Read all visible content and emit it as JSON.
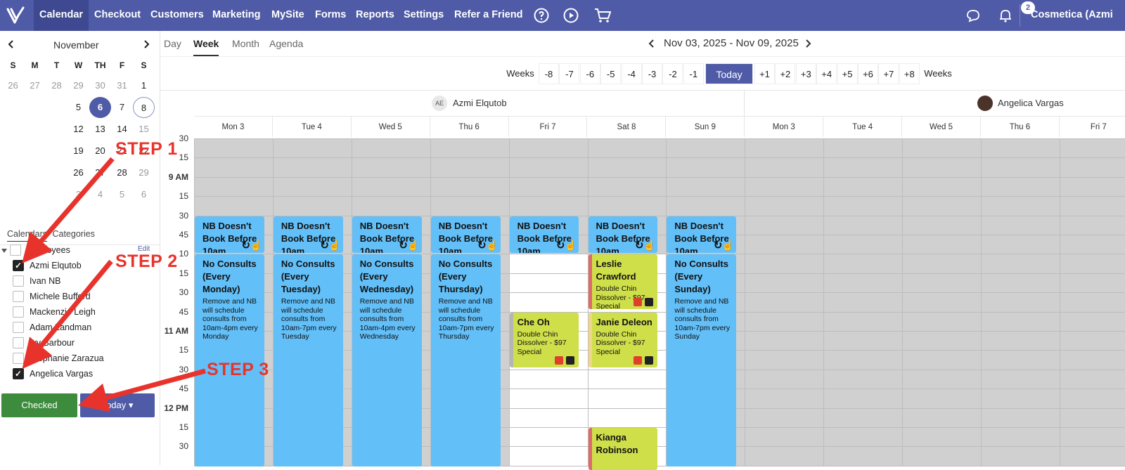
{
  "nav": {
    "items": [
      "Calendar",
      "Checkout",
      "Customers",
      "Marketing",
      "MySite",
      "Forms",
      "Reports",
      "Settings",
      "Refer a Friend"
    ],
    "notifications": "2",
    "account": "Cosmetica (Azmi"
  },
  "mini_calendar": {
    "month": "November",
    "dow": [
      "S",
      "M",
      "T",
      "W",
      "TH",
      "F",
      "S"
    ],
    "rows": [
      [
        "26",
        "27",
        "28",
        "29",
        "30",
        "31",
        "1"
      ],
      [
        "",
        "",
        "",
        "5",
        "6",
        "7",
        "8"
      ],
      [
        "",
        "",
        "",
        "12",
        "13",
        "14",
        "15"
      ],
      [
        "",
        "",
        "",
        "19",
        "20",
        "21",
        "22"
      ],
      [
        "",
        "",
        "",
        "26",
        "27",
        "28",
        "29"
      ],
      [
        "",
        "",
        "",
        "3",
        "4",
        "5",
        "6"
      ]
    ],
    "selected": "6",
    "ringed": "8"
  },
  "sidebar": {
    "tab_calendars": "Calendars",
    "tab_categories": "Categories",
    "group_label": "Employees",
    "edit": "Edit",
    "employees": [
      {
        "name": "Azmi Elqutob",
        "checked": true
      },
      {
        "name": "Ivan NB",
        "checked": false
      },
      {
        "name": "Michele Bufford",
        "checked": false
      },
      {
        "name": "Mackenzie Leigh",
        "checked": false
      },
      {
        "name": "Adam Landman",
        "checked": false
      },
      {
        "name": "Ivy Barbour",
        "checked": false
      },
      {
        "name": "Stephanie Zarazua",
        "checked": false
      },
      {
        "name": "Angelica Vargas",
        "checked": true
      }
    ],
    "checked_button": "Checked",
    "today_button": "Today"
  },
  "views": [
    "Day",
    "Week",
    "Month",
    "Agenda"
  ],
  "active_view": "Week",
  "date_range": "Nov 03, 2025 - Nov 09, 2025",
  "weeks": {
    "label": "Weeks",
    "prev": [
      "-8",
      "-7",
      "-6",
      "-5",
      "-4",
      "-3",
      "-2",
      "-1"
    ],
    "today": "Today",
    "next": [
      "+1",
      "+2",
      "+3",
      "+4",
      "+5",
      "+6",
      "+7",
      "+8"
    ]
  },
  "staff": [
    {
      "initials": "AE",
      "name": "Azmi Elqutob"
    },
    {
      "initials": "",
      "name": "Angelica Vargas"
    }
  ],
  "days_staff1": [
    "Mon 3",
    "Tue 4",
    "Wed 5",
    "Thu 6",
    "Fri 7",
    "Sat 8",
    "Sun 9"
  ],
  "days_staff2": [
    "Mon 3",
    "Tue 4",
    "Wed 5",
    "Thu 6",
    "Fri 7"
  ],
  "time_labels": [
    "30",
    "15",
    "9 AM",
    "15",
    "30",
    "45",
    "10",
    "15",
    "30",
    "45",
    "11 AM",
    "15",
    "30",
    "45",
    "12 PM",
    "15",
    "30"
  ],
  "events": {
    "nb_title": "NB Doesn't Book Before 10am",
    "nc": [
      {
        "title": "No Consults (Every Monday)",
        "desc": "Remove and NB will schedule consults from 10am-4pm every Monday"
      },
      {
        "title": "No Consults (Every Tuesday)",
        "desc": "Remove and NB will schedule consults from 10am-7pm every Tuesday"
      },
      {
        "title": "No Consults (Every Wednesday)",
        "desc": "Remove and NB will schedule consults from 10am-4pm every Wednesday"
      },
      {
        "title": "No Consults (Every Thursday)",
        "desc": "Remove and NB will schedule consults from 10am-7pm every Thursday"
      },
      {
        "title": "No Consults (Every Sunday)",
        "desc": "Remove and NB will schedule consults from 10am-7pm every Sunday"
      }
    ],
    "appts": [
      {
        "name": "Che Oh",
        "service": "Double Chin Dissolver - $97 Special"
      },
      {
        "name": "Leslie Crawford",
        "service": "Double Chin Dissolver - $97 Special"
      },
      {
        "name": "Janie Deleon",
        "service": "Double Chin Dissolver - $97 Special"
      },
      {
        "name": "Kianga Robinson",
        "service": ""
      }
    ]
  },
  "steps": [
    "STEP 1",
    "STEP 2",
    "STEP 3"
  ],
  "colors": {
    "nav": "#4f5ba6",
    "event_blue": "#62bff8",
    "event_lime": "#cfdf4a",
    "step_red": "#e8332c",
    "checked_green": "#3d8b3d"
  }
}
